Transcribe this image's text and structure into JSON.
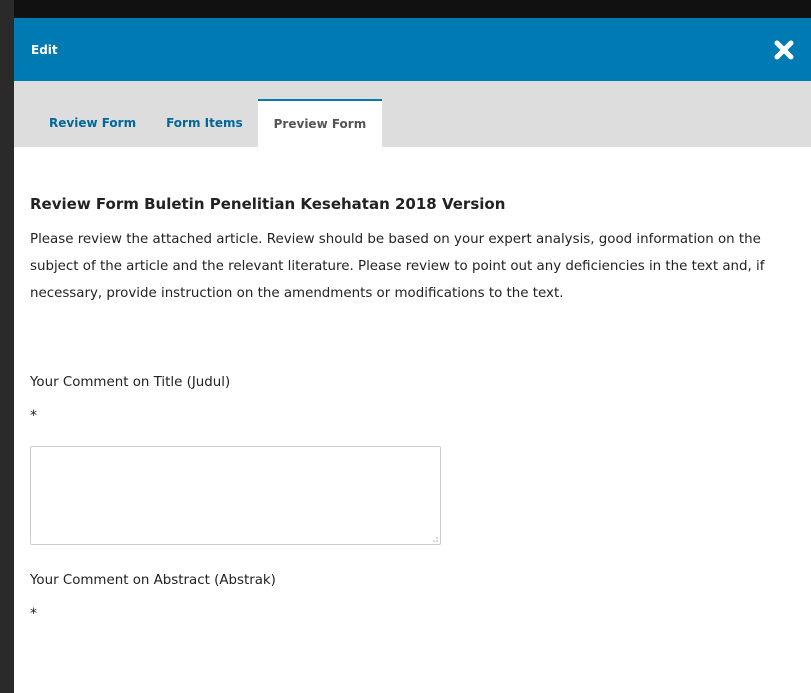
{
  "modal": {
    "title": "Edit",
    "close_icon": "close-icon"
  },
  "tabs": [
    {
      "label": "Review Form",
      "active": false
    },
    {
      "label": "Form Items",
      "active": false
    },
    {
      "label": "Preview Form",
      "active": true
    }
  ],
  "preview": {
    "title": "Review Form Buletin Penelitian Kesehatan 2018 Version",
    "description": "Please review the attached article. Review should be based on your expert analysis, good information on the subject of the article and the relevant literature. Please review to point out any deficiencies in the text and, if necessary, provide instruction on the amendments or modifications to the text.",
    "fields": [
      {
        "label": "Your Comment on Title (Judul)",
        "required_mark": "*",
        "value": ""
      },
      {
        "label": "Your Comment on Abstract (Abstrak)",
        "required_mark": "*"
      }
    ]
  },
  "colors": {
    "header": "#007ab2",
    "tab_bar": "#dddddd",
    "tab_link": "#006798"
  }
}
